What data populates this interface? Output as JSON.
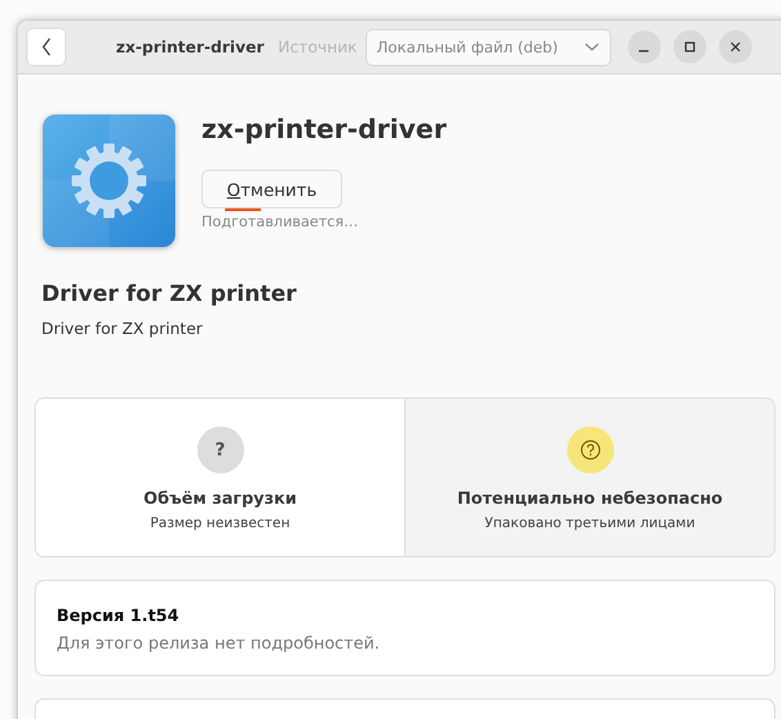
{
  "window": {
    "title": "zx-printer-driver",
    "source_label": "Источник",
    "source_dropdown": "Локальный файл (deb)"
  },
  "app": {
    "name": "zx-printer-driver",
    "cancel_button": "Отменить",
    "progress": {
      "level": 0.25
    },
    "status": "Подготавливается…"
  },
  "summary": {
    "heading": "Driver for ZX printer",
    "description": "Driver for ZX printer"
  },
  "tiles": [
    {
      "kind": "neutral",
      "icon_text": "?",
      "title": "Объём загрузки",
      "subtitle": "Размер неизвестен",
      "highlighted": false
    },
    {
      "kind": "warning",
      "title": "Потенциально небезопасно",
      "subtitle": "Упаковано третьими лицами",
      "highlighted": true
    }
  ],
  "version": {
    "title": "Версия 1.t54",
    "details": "Для этого релиза нет подробностей."
  }
}
